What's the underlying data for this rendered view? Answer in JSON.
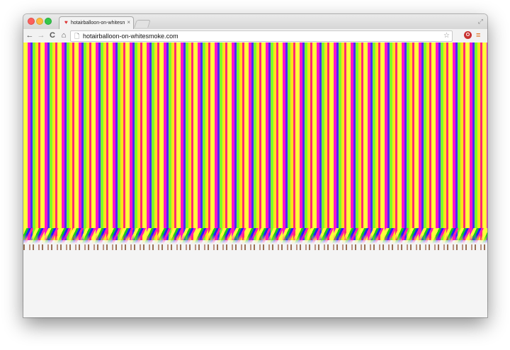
{
  "browser": {
    "tab": {
      "title": "hotairballoon-on-whitesmoke.com",
      "favicon": "balloon-favicon-icon",
      "close_glyph": "×"
    },
    "toolbar": {
      "back_glyph": "←",
      "forward_glyph": "→",
      "reload_glyph": "C",
      "home_glyph": "⌂",
      "page_glyph": "🗋",
      "url": "hotairballoon-on-whitesmoke.com",
      "star_glyph": "☆",
      "extension_glyph": "O",
      "menu_glyph": "≡"
    },
    "fullscreen_glyph": "⤢"
  },
  "page": {
    "background_color": "#f4f4f4",
    "pattern_colors": [
      "#ffff3a",
      "#ff15c8",
      "#4b2dff",
      "#7cff2a",
      "#ffe11a",
      "#ff2a73"
    ]
  }
}
